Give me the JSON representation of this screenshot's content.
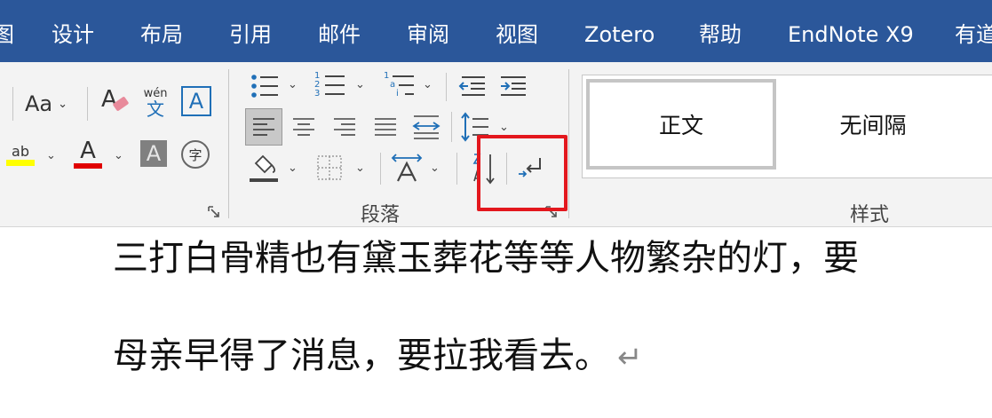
{
  "tabs": [
    "图",
    "设计",
    "布局",
    "引用",
    "邮件",
    "审阅",
    "视图",
    "Zotero",
    "帮助",
    "EndNote X9",
    "有道"
  ],
  "font_group": {
    "change_case_label": "Aa",
    "clear_format_glyph": "A",
    "phonetic_top": "wén",
    "phonetic_bottom": "文",
    "char_border_glyph": "A",
    "highlight_glyph": "ab",
    "font_color_glyph": "A",
    "char_shading_glyph": "A",
    "enclose_char_glyph": "字",
    "highlight_color": "#ffff00",
    "font_color": "#e00000"
  },
  "paragraph_group": {
    "label": "段落",
    "numbering_digits": [
      "1",
      "2",
      "3"
    ],
    "multilevel_marks": [
      "1",
      "a",
      "i"
    ]
  },
  "styles_group": {
    "label": "样式",
    "items": [
      "正文",
      "无间隔"
    ]
  },
  "highlight_color": "#e3171d",
  "document": {
    "lines": [
      "三打白骨精也有黛玉葬花等等人物繁杂的灯，要",
      "母亲早得了消息，要拉我看去。"
    ],
    "paragraph_mark": "↵"
  }
}
